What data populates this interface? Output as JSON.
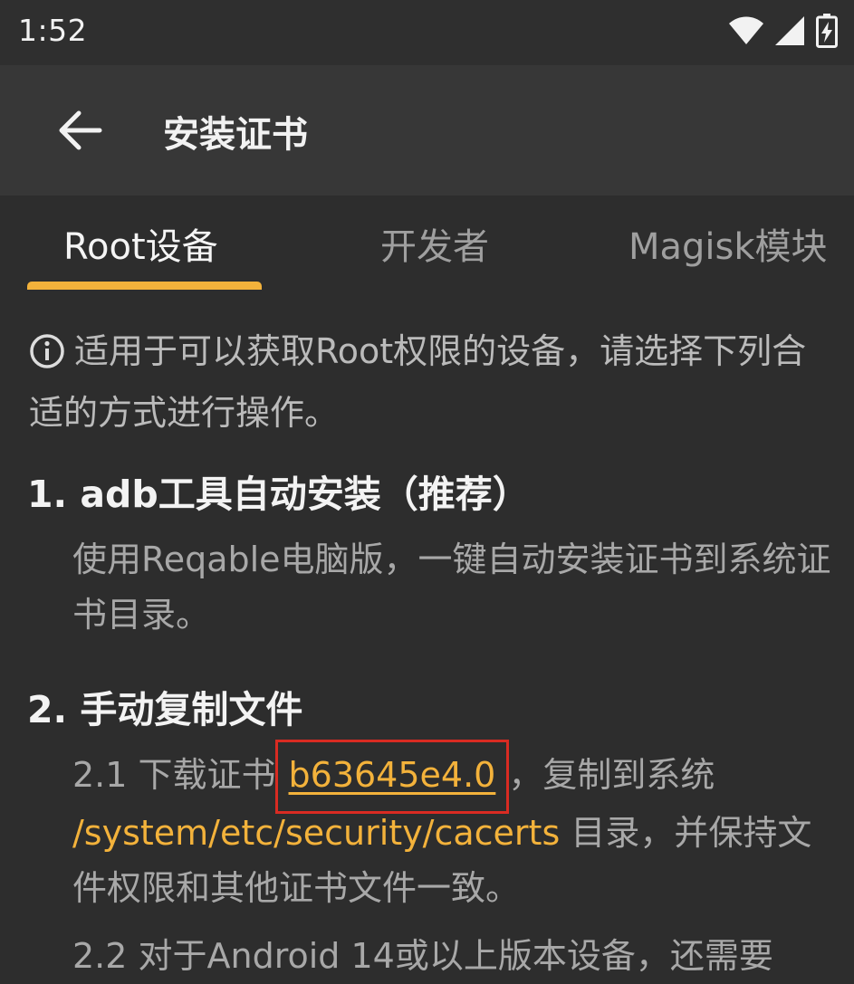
{
  "status_bar": {
    "time": "1:52",
    "icons": [
      "wifi-icon",
      "cell-signal-icon",
      "battery-charging-icon"
    ]
  },
  "app_bar": {
    "back_icon": "back-arrow-icon",
    "title": "安装证书"
  },
  "tabs": [
    {
      "label": "Root设备",
      "active": true
    },
    {
      "label": "开发者",
      "active": false
    },
    {
      "label": "Magisk模块",
      "active": false
    }
  ],
  "accent_color": "#f3b23b",
  "info": {
    "icon": "info-icon",
    "text": "适用于可以获取Root权限的设备，请选择下列合适的方式进行操作。"
  },
  "section1": {
    "title": "1. adb工具自动安装（推荐）",
    "body": "使用Reqable电脑版，一键自动安装证书到系统证书目录。"
  },
  "section2": {
    "title": "2. 手动复制文件",
    "step1_prefix": "2.1 下载证书",
    "step1_link": "b63645e4.0",
    "step1_mid": "，复制到系统 ",
    "step1_path": "/system/etc/security/cacerts",
    "step1_suffix": " 目录，并保持文件权限和其他证书文件一致。",
    "step2_partial": "2.2 对于Android 14或以上版本设备，还需要"
  }
}
